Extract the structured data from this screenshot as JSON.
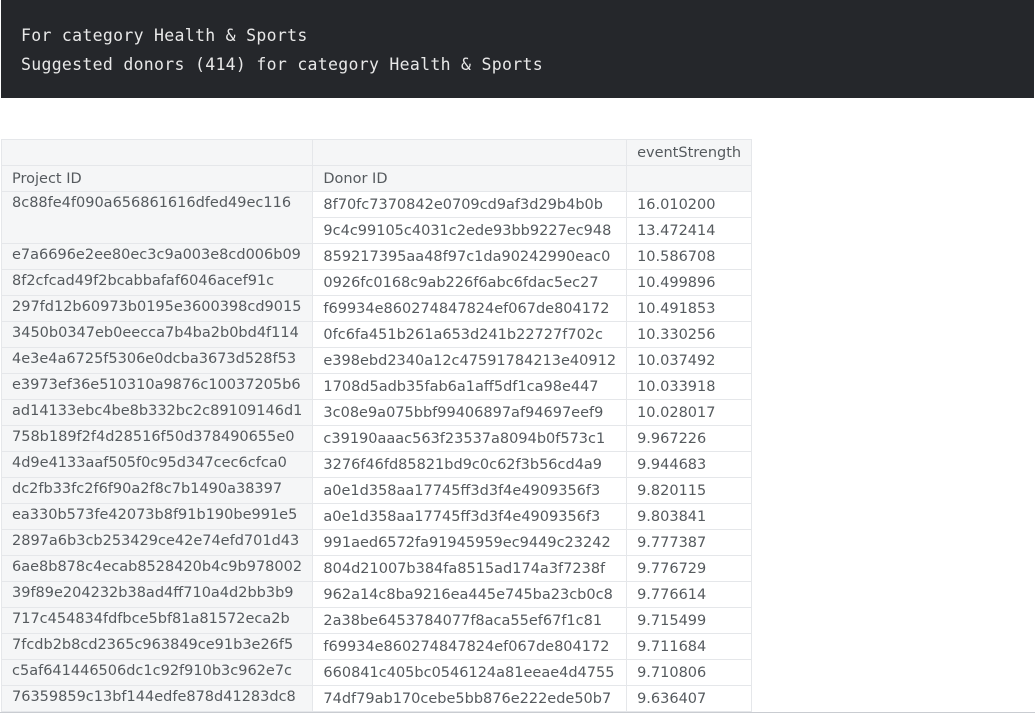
{
  "output": {
    "lines": [
      "For category Health & Sports",
      "Suggested donors (414) for category Health & Sports"
    ]
  },
  "table": {
    "column_header": "eventStrength",
    "index_names": [
      "Project ID",
      "Donor ID"
    ],
    "rows": [
      {
        "project": "8c88fe4f090a656861616dfed49ec116",
        "donor": "8f70fc7370842e0709cd9af3d29b4b0b",
        "strength": "16.010200",
        "span": 2
      },
      {
        "project": "",
        "donor": "9c4c99105c4031c2ede93bb9227ec948",
        "strength": "13.472414",
        "span": 0
      },
      {
        "project": "e7a6696e2ee80ec3c9a003e8cd006b09",
        "donor": "859217395aa48f97c1da90242990eac0",
        "strength": "10.586708",
        "span": 1
      },
      {
        "project": "8f2cfcad49f2bcabbafaf6046acef91c",
        "donor": "0926fc0168c9ab226f6abc6fdac5ec27",
        "strength": "10.499896",
        "span": 1
      },
      {
        "project": "297fd12b60973b0195e3600398cd9015",
        "donor": "f69934e860274847824ef067de804172",
        "strength": "10.491853",
        "span": 1
      },
      {
        "project": "3450b0347eb0eecca7b4ba2b0bd4f114",
        "donor": "0fc6fa451b261a653d241b22727f702c",
        "strength": "10.330256",
        "span": 1
      },
      {
        "project": "4e3e4a6725f5306e0dcba3673d528f53",
        "donor": "e398ebd2340a12c47591784213e40912",
        "strength": "10.037492",
        "span": 1
      },
      {
        "project": "e3973ef36e510310a9876c10037205b6",
        "donor": "1708d5adb35fab6a1aff5df1ca98e447",
        "strength": "10.033918",
        "span": 1
      },
      {
        "project": "ad14133ebc4be8b332bc2c89109146d1",
        "donor": "3c08e9a075bbf99406897af94697eef9",
        "strength": "10.028017",
        "span": 1
      },
      {
        "project": "758b189f2f4d28516f50d378490655e0",
        "donor": "c39190aaac563f23537a8094b0f573c1",
        "strength": "9.967226",
        "span": 1
      },
      {
        "project": "4d9e4133aaf505f0c95d347cec6cfca0",
        "donor": "3276f46fd85821bd9c0c62f3b56cd4a9",
        "strength": "9.944683",
        "span": 1
      },
      {
        "project": "dc2fb33fc2f6f90a2f8c7b1490a38397",
        "donor": "a0e1d358aa17745ff3d3f4e4909356f3",
        "strength": "9.820115",
        "span": 1
      },
      {
        "project": "ea330b573fe42073b8f91b190be991e5",
        "donor": "a0e1d358aa17745ff3d3f4e4909356f3",
        "strength": "9.803841",
        "span": 1
      },
      {
        "project": "2897a6b3cb253429ce42e74efd701d43",
        "donor": "991aed6572fa91945959ec9449c23242",
        "strength": "9.777387",
        "span": 1
      },
      {
        "project": "6ae8b878c4ecab8528420b4c9b978002",
        "donor": "804d21007b384fa8515ad174a3f7238f",
        "strength": "9.776729",
        "span": 1
      },
      {
        "project": "39f89e204232b38ad4ff710a4d2bb3b9",
        "donor": "962a14c8ba9216ea445e745ba23cb0c8",
        "strength": "9.776614",
        "span": 1
      },
      {
        "project": "717c454834fdfbce5bf81a81572eca2b",
        "donor": "2a38be6453784077f8aca55ef67f1c81",
        "strength": "9.715499",
        "span": 1
      },
      {
        "project": "7fcdb2b8cd2365c963849ce91b3e26f5",
        "donor": "f69934e860274847824ef067de804172",
        "strength": "9.711684",
        "span": 1
      },
      {
        "project": "c5af641446506dc1c92f910b3c962e7c",
        "donor": "660841c405bc0546124a81eeae4d4755",
        "strength": "9.710806",
        "span": 1
      },
      {
        "project": "76359859c13bf144edfe878d41283dc8",
        "donor": "74df79ab170cebe5bb876e222ede50b7",
        "strength": "9.636407",
        "span": 1
      }
    ]
  }
}
